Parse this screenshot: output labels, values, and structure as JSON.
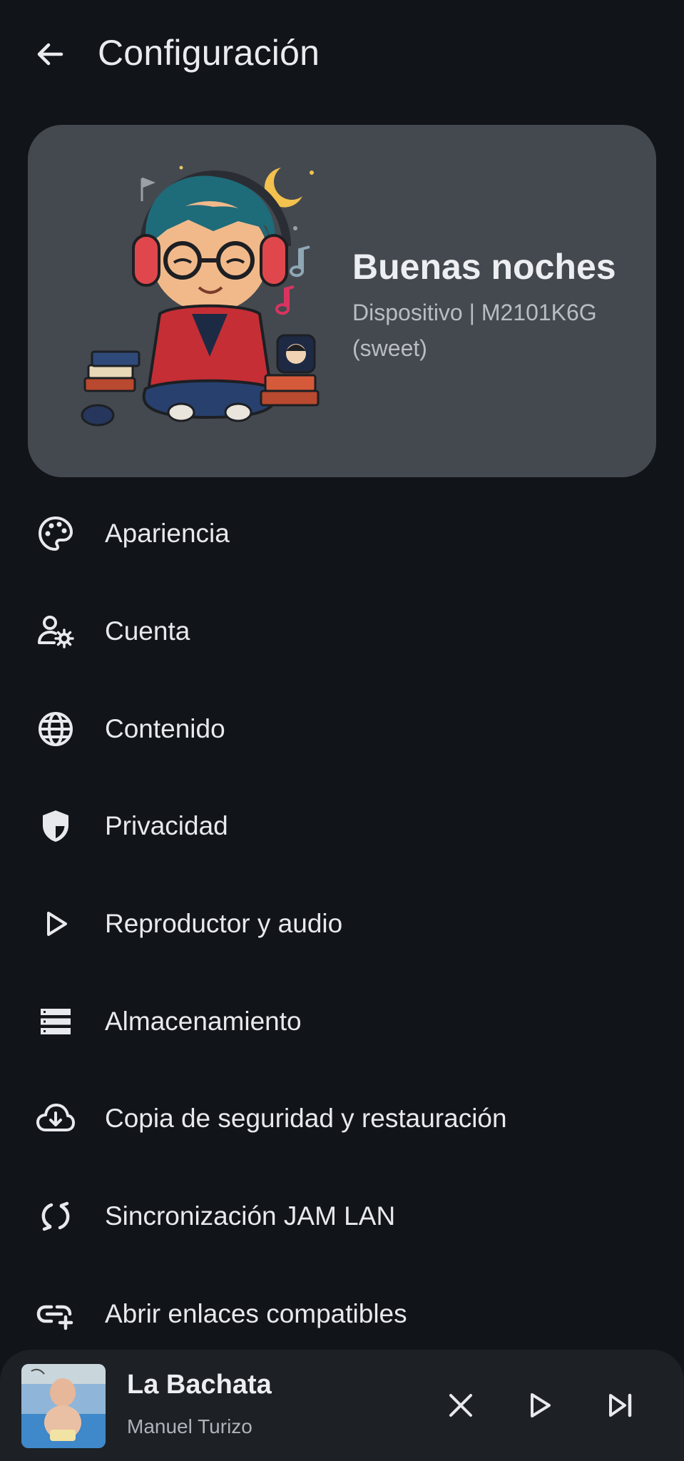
{
  "header": {
    "title": "Configuración",
    "back_icon": "arrow-left-icon"
  },
  "profile_card": {
    "greeting": "Buenas noches",
    "device_line1": "Dispositivo | M2101K6G",
    "device_line2": "(sweet)",
    "illustration": "headphones-boy-illustration"
  },
  "settings": [
    {
      "label": "Apariencia",
      "icon": "palette-icon"
    },
    {
      "label": "Cuenta",
      "icon": "user-settings-icon"
    },
    {
      "label": "Contenido",
      "icon": "globe-icon"
    },
    {
      "label": "Privacidad",
      "icon": "shield-icon"
    },
    {
      "label": "Reproductor y audio",
      "icon": "play-icon"
    },
    {
      "label": "Almacenamiento",
      "icon": "storage-icon"
    },
    {
      "label": "Copia de seguridad y restauración",
      "icon": "cloud-download-icon"
    },
    {
      "label": "Sincronización JAM LAN",
      "icon": "sync-icon"
    },
    {
      "label": "Abrir enlaces compatibles",
      "icon": "add-link-icon"
    }
  ],
  "now_playing": {
    "title": "La Bachata",
    "artist": "Manuel Turizo",
    "controls": [
      "close-icon",
      "play-icon",
      "skip-next-icon"
    ]
  },
  "colors": {
    "background": "#111418",
    "card": "#44494f",
    "player": "#1d2126",
    "text": "#e7e9ed",
    "subtext": "#b9bdc3"
  }
}
